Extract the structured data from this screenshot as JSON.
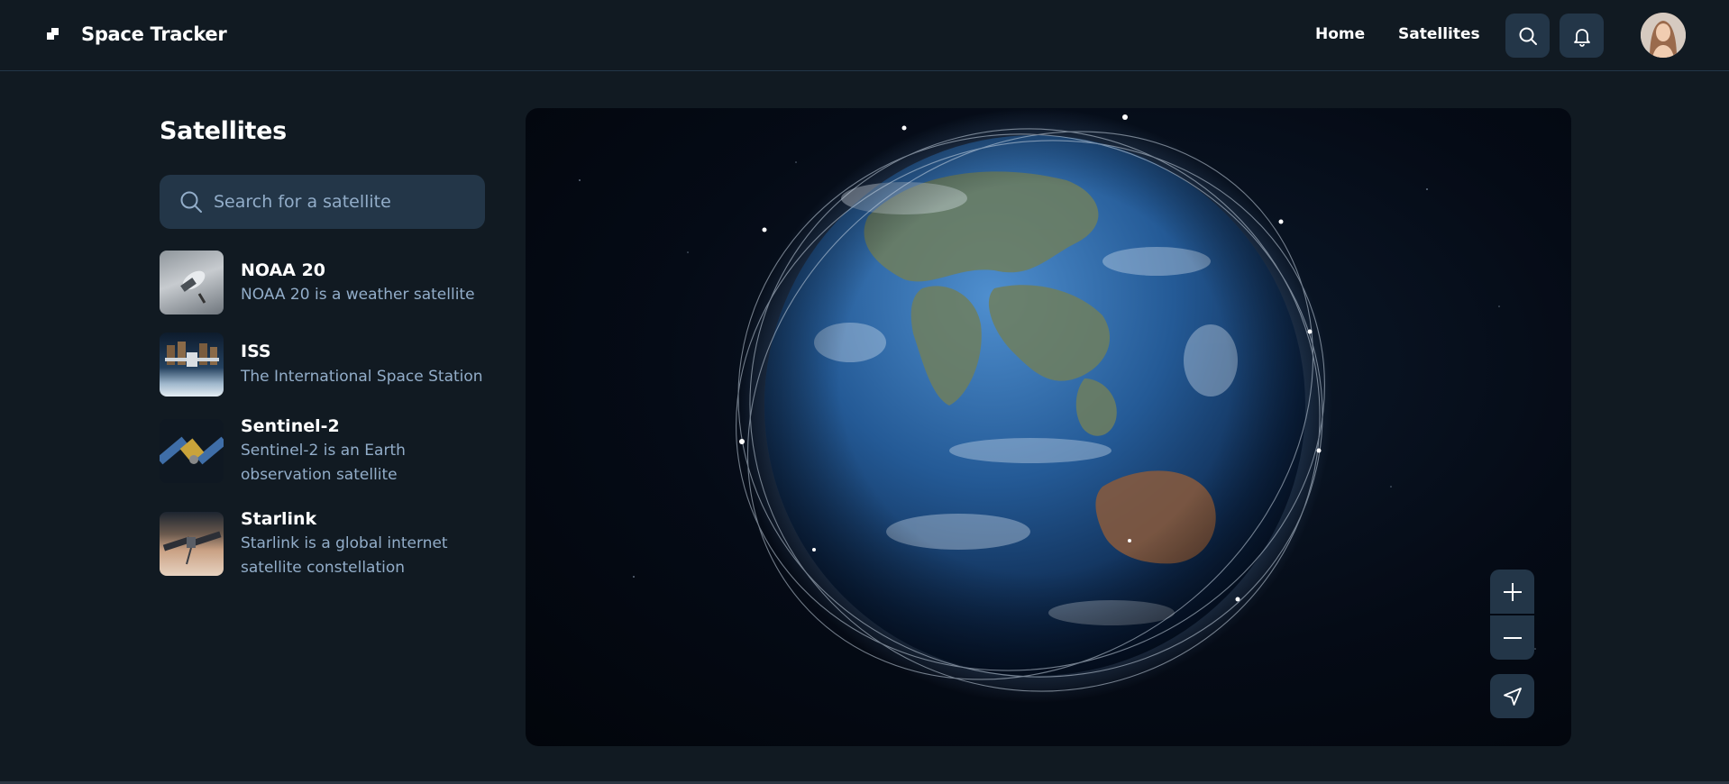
{
  "app": {
    "title": "Space Tracker"
  },
  "nav": [
    {
      "label": "Home"
    },
    {
      "label": "Satellites"
    }
  ],
  "header_icons": [
    "search-icon",
    "bell-icon"
  ],
  "panel": {
    "title": "Satellites",
    "search": {
      "placeholder": "Search for a satellite",
      "value": ""
    }
  },
  "satellites": [
    {
      "name": "NOAA 20",
      "description": "NOAA 20 is a weather satellite"
    },
    {
      "name": "ISS",
      "description": "The International Space Station"
    },
    {
      "name": "Sentinel-2",
      "description": "Sentinel-2 is an Earth observation satellite"
    },
    {
      "name": "Starlink",
      "description": "Starlink is a global internet satellite constellation"
    }
  ],
  "map_controls": [
    "plus-icon",
    "minus-icon",
    "navigation-arrow-icon"
  ],
  "colors": {
    "background": "#111a22",
    "surface": "#233648",
    "muted_text": "#92adc9",
    "text": "#ffffff"
  }
}
